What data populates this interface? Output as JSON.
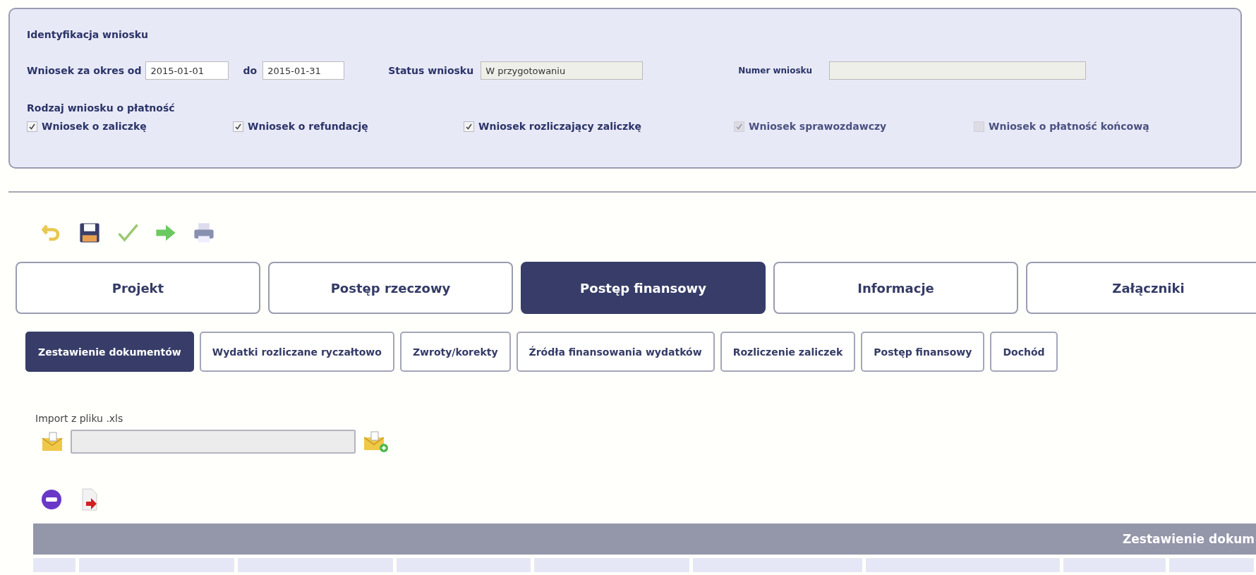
{
  "identification": {
    "title": "Identyfikacja wniosku",
    "period_label": "Wniosek za okres od",
    "period_from": "2015-01-01",
    "period_to_label": "do",
    "period_to": "2015-01-31",
    "status_label": "Status wniosku",
    "status_value": "W przygotowaniu",
    "number_label": "Numer wniosku",
    "type_label": "Rodzaj wniosku o płatność",
    "types": [
      {
        "label": "Wniosek o zaliczkę",
        "checked": true,
        "disabled": false
      },
      {
        "label": "Wniosek o refundację",
        "checked": true,
        "disabled": false
      },
      {
        "label": "Wniosek rozliczający zaliczkę",
        "checked": true,
        "disabled": false
      },
      {
        "label": "Wniosek sprawozdawczy",
        "checked": true,
        "disabled": true
      },
      {
        "label": "Wniosek o płatność końcową",
        "checked": false,
        "disabled": true
      }
    ]
  },
  "main_tabs": [
    {
      "label": "Projekt",
      "selected": false
    },
    {
      "label": "Postęp rzeczowy",
      "selected": false
    },
    {
      "label": "Postęp finansowy",
      "selected": true
    },
    {
      "label": "Informacje",
      "selected": false
    },
    {
      "label": "Załączniki",
      "selected": false
    }
  ],
  "sub_tabs": [
    {
      "label": "Zestawienie dokumentów",
      "selected": true
    },
    {
      "label": "Wydatki rozliczane ryczałtowo",
      "selected": false
    },
    {
      "label": "Zwroty/korekty",
      "selected": false
    },
    {
      "label": "Źródła finansowania wydatków",
      "selected": false
    },
    {
      "label": "Rozliczenie zaliczek",
      "selected": false
    },
    {
      "label": "Postęp finansowy",
      "selected": false
    },
    {
      "label": "Dochód",
      "selected": false
    }
  ],
  "import": {
    "label": "Import z pliku .xls"
  },
  "table": {
    "title": "Zestawienie dokum"
  }
}
